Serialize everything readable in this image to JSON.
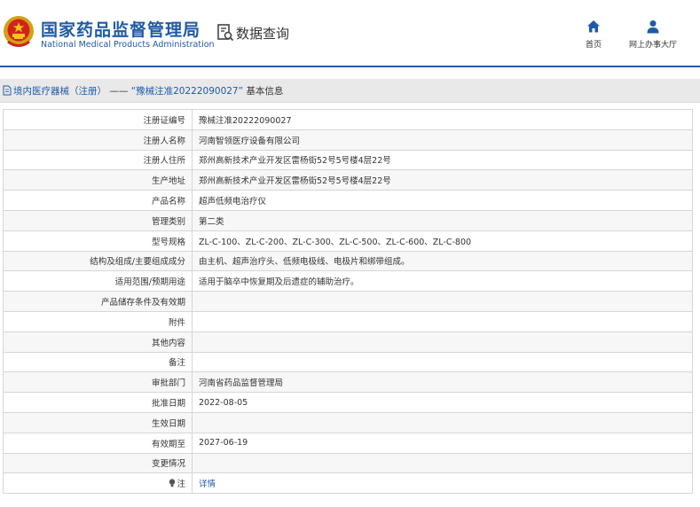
{
  "header": {
    "title": "国家药品监督管理局",
    "subtitle": "National Medical Products Administration",
    "query_label": "数据查询",
    "nav": [
      {
        "label": "首页",
        "icon": "home-icon"
      },
      {
        "label": "网上办事大厅",
        "icon": "user-icon"
      }
    ],
    "accent_color": "#1f5aa6"
  },
  "breadcrumb": {
    "category": "境内医疗器械（注册）",
    "separator": " —— ",
    "record": "“豫械注准20222090027”",
    "suffix": " 基本信息"
  },
  "rows": [
    {
      "label": "注册证编号",
      "value": "豫械注准20222090027"
    },
    {
      "label": "注册人名称",
      "value": "河南智领医疗设备有限公司"
    },
    {
      "label": "注册人住所",
      "value": "郑州高新技术产业开发区雷杨街52号5号楼4层22号"
    },
    {
      "label": "生产地址",
      "value": "郑州高新技术产业开发区雷杨街52号5号楼4层22号"
    },
    {
      "label": "产品名称",
      "value": "超声低频电治疗仪"
    },
    {
      "label": "管理类别",
      "value": "第二类"
    },
    {
      "label": "型号规格",
      "value": "ZL-C-100、ZL-C-200、ZL-C-300、ZL-C-500、ZL-C-600、ZL-C-800"
    },
    {
      "label": "结构及组成/主要组成成分",
      "value": "由主机、超声治疗头、低频电极线、电极片和绑带组成。"
    },
    {
      "label": "适用范围/预期用途",
      "value": "适用于脑卒中恢复期及后遗症的辅助治疗。"
    },
    {
      "label": "产品储存条件及有效期",
      "value": ""
    },
    {
      "label": "附件",
      "value": ""
    },
    {
      "label": "其他内容",
      "value": ""
    },
    {
      "label": "备注",
      "value": ""
    },
    {
      "label": "审批部门",
      "value": "河南省药品监督管理局"
    },
    {
      "label": "批准日期",
      "value": "2022-08-05"
    },
    {
      "label": "生效日期",
      "value": ""
    },
    {
      "label": "有效期至",
      "value": "2027-06-19"
    },
    {
      "label": "变更情况",
      "value": ""
    },
    {
      "label": "注",
      "value": "详情",
      "icon": "bulb-icon"
    }
  ]
}
